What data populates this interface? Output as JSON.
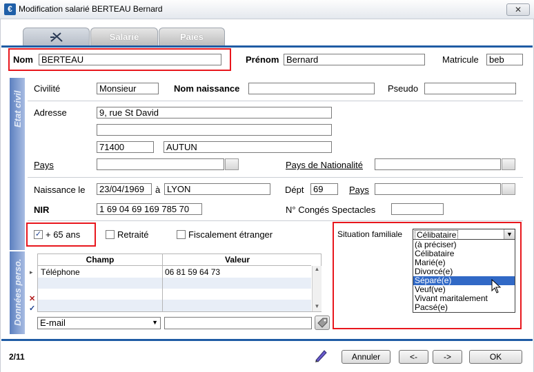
{
  "window": {
    "title": "Modification salarié BERTEAU Bernard",
    "close_glyph": "✕"
  },
  "tabs": [
    {
      "label": "",
      "icon": "tool-icon"
    },
    {
      "label": "Salarié"
    },
    {
      "label": "Paies"
    }
  ],
  "identity": {
    "nom_label": "Nom",
    "nom_value": "BERTEAU",
    "prenom_label": "Prénom",
    "prenom_value": "Bernard",
    "matricule_label": "Matricule",
    "matricule_value": "beb"
  },
  "etat_civil": {
    "section_label": "Etat civil",
    "civilite_label": "Civilité",
    "civilite_value": "Monsieur",
    "nom_naissance_label": "Nom naissance",
    "nom_naissance_value": "",
    "pseudo_label": "Pseudo",
    "pseudo_value": "",
    "adresse_label": "Adresse",
    "adresse_line1": "9, rue St David",
    "adresse_line2": "",
    "code_postal": "71400",
    "ville": "AUTUN",
    "pays_label": "Pays",
    "pays_value": "",
    "pays_nationalite_label": "Pays de Nationalité",
    "pays_nationalite_value": "",
    "naissance_label": "Naissance le",
    "naissance_date": "23/04/1969",
    "a_label": "à",
    "naissance_lieu": "LYON",
    "dept_label": "Dépt",
    "dept_value": "69",
    "pays2_label": "Pays",
    "pays2_value": "",
    "nir_label": "NIR",
    "nir_value": "1 69 04 69 169 785 70",
    "conges_label": "N° Congés Spectacles",
    "conges_value": ""
  },
  "checks": {
    "plus65_label": "+ 65 ans",
    "plus65_checked": true,
    "check_glyph": "✓",
    "retraite_label": "Retraité",
    "retraite_checked": false,
    "fiscal_label": "Fiscalement étranger",
    "fiscal_checked": false
  },
  "situation": {
    "label": "Situation familiale",
    "selected": "Célibataire",
    "options": [
      "(à préciser)",
      "Célibataire",
      "Marié(e)",
      "Divorcé(e)",
      "Séparé(e)",
      "Veuf(ve)",
      "Vivant maritalement",
      "Pacsé(e)"
    ],
    "highlighted_index": 4
  },
  "donnees": {
    "section_label": "Données perso.",
    "columns": [
      "Champ",
      "Valeur"
    ],
    "rows": [
      {
        "champ": "Téléphone",
        "valeur": "06 81 59 64 73"
      },
      {
        "champ": "",
        "valeur": ""
      },
      {
        "champ": "",
        "valeur": ""
      },
      {
        "champ": "",
        "valeur": ""
      }
    ],
    "new_field_type": "E-mail",
    "new_field_value": ""
  },
  "footer": {
    "record_counter": "2/11",
    "annuler_label": "Annuler",
    "prev_label": "<-",
    "next_label": "->",
    "ok_label": "OK"
  },
  "colors": {
    "accent": "#1f5ba4",
    "highlight_box": "#e8161c",
    "selection": "#3169c6"
  }
}
